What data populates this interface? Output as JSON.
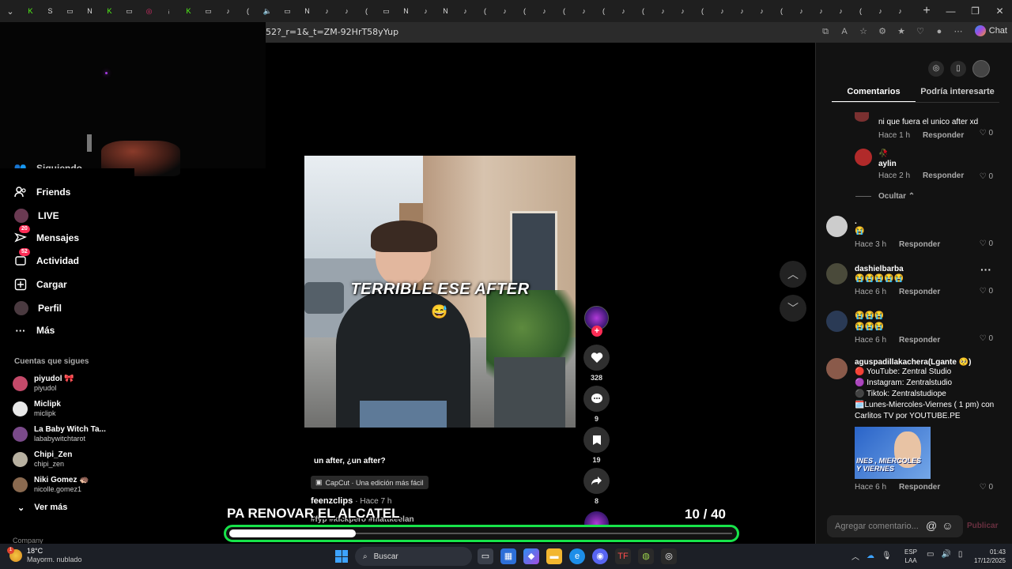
{
  "browser": {
    "url": "52?_r=1&_t=ZM-92HrT58yYup",
    "chat_label": "Chat"
  },
  "sidebar": {
    "items": [
      {
        "label": "Siguiendo",
        "icon": "following-icon"
      },
      {
        "label": "Friends",
        "icon": "friends-icon"
      },
      {
        "label": "LIVE",
        "icon": "live-icon"
      },
      {
        "label": "Mensajes",
        "icon": "messages-icon",
        "badge": "20"
      },
      {
        "label": "Actividad",
        "icon": "activity-icon",
        "badge": "52"
      },
      {
        "label": "Cargar",
        "icon": "upload-icon"
      },
      {
        "label": "Perfil",
        "icon": "profile-icon"
      },
      {
        "label": "Más",
        "icon": "more-icon"
      }
    ],
    "following_title": "Cuentas que sigues",
    "following": [
      {
        "name": "piyudol 🎀",
        "username": "piyudol",
        "color": "#c44a6a"
      },
      {
        "name": "Miclipk",
        "username": "miclipk",
        "color": "#e8e8e8"
      },
      {
        "name": "La Baby Witch Ta...",
        "username": "lababywitchtarot",
        "color": "#7a4a8a"
      },
      {
        "name": "Chipi_Zen",
        "username": "chipi_zen",
        "color": "#b7b0a0"
      },
      {
        "name": "Niki Gomez 🦔",
        "username": "nicolle.gomez1",
        "color": "#8a6a50"
      }
    ],
    "see_more": "Ver más",
    "company": "Company"
  },
  "video": {
    "caption": "TERRIBLE ESE AFTER",
    "description_title": "un after, ¿un after?",
    "capcut_label": "CapCut · Una edición más fácil",
    "author": "feenzclips",
    "posted": "· Hace 7 h",
    "hashtags": "#fyp #kickpero #mattkeelan"
  },
  "actions": {
    "likes": "328",
    "comments": "9",
    "saves": "19",
    "shares": "8"
  },
  "stream_overlay": {
    "goal_text": "PA RENOVAR EL ALCATEL",
    "count_text": "10  / 40",
    "progress_fraction": 0.25,
    "accent": "#17e34a"
  },
  "comments_panel": {
    "tabs": [
      {
        "label": "Comentarios",
        "active": true
      },
      {
        "label": "Podría interesarte",
        "active": false
      }
    ],
    "hide_label": "Ocultar ⌃",
    "reply_label": "Responder",
    "comments": [
      {
        "user": "",
        "text": "ni que fuera el unico after xd",
        "time": "Hace 1 h",
        "likes": "0",
        "color": "#7a3030"
      },
      {
        "user": "aylin",
        "text": "🥀",
        "time": "Hace 2 h",
        "likes": "0",
        "color": "#b12a2a"
      },
      {
        "user": ".",
        "text": "😭",
        "time": "Hace 3 h",
        "likes": "0",
        "color": "#cccccc"
      },
      {
        "user": "dashielbarba",
        "text": "😭😭😭😭😭",
        "time": "Hace 6 h",
        "likes": "0",
        "color": "#4a4a3a"
      },
      {
        "user": "",
        "text": "😭😭😭 😭😭😭",
        "time": "Hace 6 h",
        "likes": "0",
        "color": "#2a3a55"
      },
      {
        "user": "aguspadillakachera(Lgante 🥺)",
        "text": "🔴 YouTube: Zentral Studio",
        "time": "Hace 6 h",
        "likes": "0",
        "color": "#8a5a4a"
      }
    ],
    "long_comment_lines": [
      "🔴 YouTube: Zentral Studio",
      "🟣 Instagram: Zentralstudio",
      "⚫ Tiktok: Zentralstudiope",
      "🗓️Lunes-Miercoles-Viernes ( 1 pm) con Carlitos TV por YOUTUBE.PE"
    ],
    "thumb_text": "INES , MIERCOLES\nY VIERNES",
    "input_placeholder": "Agregar comentario...",
    "publish_label": "Publicar"
  },
  "taskbar": {
    "temperature": "18°C",
    "condition": "Mayorm. nublado",
    "weather_badge": "1",
    "search_label": "Buscar",
    "lang_line1": "ESP",
    "lang_line2": "LAA",
    "time": "01:43",
    "date": "17/12/2025"
  }
}
